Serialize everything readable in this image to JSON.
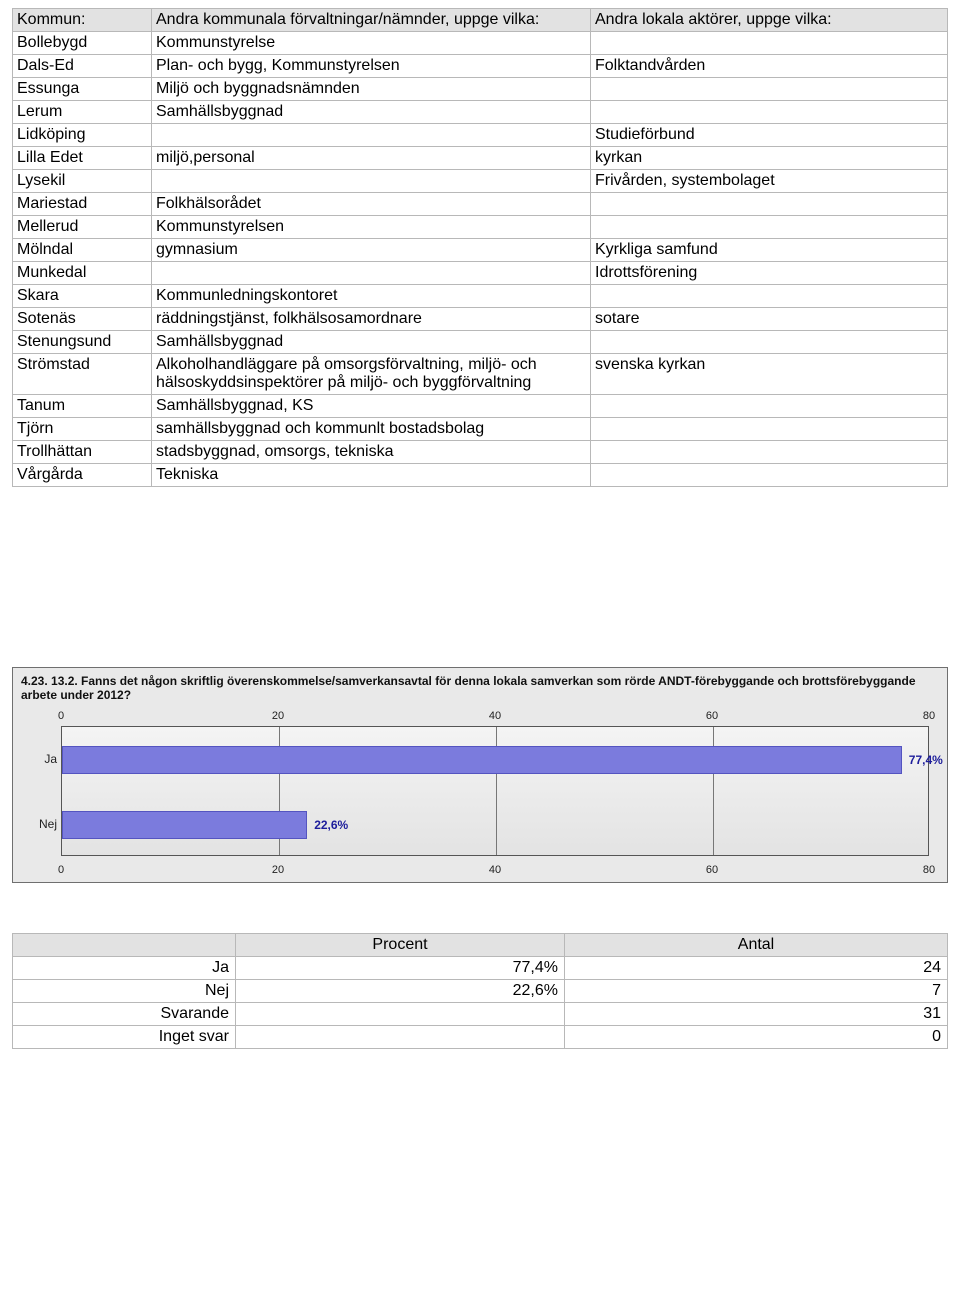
{
  "table": {
    "headers": {
      "kommun": "Kommun:",
      "andra_kommunala": "Andra kommunala förvaltningar/nämnder, uppge vilka:",
      "andra_lokala": "Andra lokala aktörer, uppge vilka:"
    },
    "rows": [
      {
        "kommun": "Bollebygd",
        "c1": "Kommunstyrelse",
        "c2": ""
      },
      {
        "kommun": "Dals-Ed",
        "c1": "Plan- och bygg, Kommunstyrelsen",
        "c2": "Folktandvården"
      },
      {
        "kommun": "Essunga",
        "c1": "Miljö och byggnadsnämnden",
        "c2": ""
      },
      {
        "kommun": "Lerum",
        "c1": "Samhällsbyggnad",
        "c2": ""
      },
      {
        "kommun": "Lidköping",
        "c1": "",
        "c2": "Studieförbund"
      },
      {
        "kommun": "Lilla Edet",
        "c1": "miljö,personal",
        "c2": "kyrkan"
      },
      {
        "kommun": "Lysekil",
        "c1": "",
        "c2": "Frivården, systembolaget"
      },
      {
        "kommun": "Mariestad",
        "c1": "Folkhälsorådet",
        "c2": ""
      },
      {
        "kommun": "Mellerud",
        "c1": "Kommunstyrelsen",
        "c2": ""
      },
      {
        "kommun": "Mölndal",
        "c1": "gymnasium",
        "c2": "Kyrkliga samfund"
      },
      {
        "kommun": "Munkedal",
        "c1": "",
        "c2": "Idrottsförening"
      },
      {
        "kommun": "Skara",
        "c1": "Kommunledningskontoret",
        "c2": ""
      },
      {
        "kommun": "Sotenäs",
        "c1": "räddningstjänst, folkhälsosamordnare",
        "c2": "sotare"
      },
      {
        "kommun": "Stenungsund",
        "c1": "Samhällsbyggnad",
        "c2": ""
      },
      {
        "kommun": "Strömstad",
        "c1": "Alkoholhandläggare på omsorgsförvaltning, miljö- och hälsoskyddsinspektörer på miljö- och byggförvaltning",
        "c2": "svenska kyrkan"
      },
      {
        "kommun": "Tanum",
        "c1": "Samhällsbyggnad, KS",
        "c2": ""
      },
      {
        "kommun": "Tjörn",
        "c1": "samhällsbyggnad och kommunlt bostadsbolag",
        "c2": ""
      },
      {
        "kommun": "Trollhättan",
        "c1": "stadsbyggnad, omsorgs, tekniska",
        "c2": ""
      },
      {
        "kommun": "Vårgårda",
        "c1": "Tekniska",
        "c2": ""
      }
    ]
  },
  "chart_data": {
    "type": "bar",
    "orientation": "horizontal",
    "title": "4.23. 13.2. Fanns det någon skriftlig överenskommelse/samverkansavtal för denna lokala samverkan som rörde ANDT-förebyggande och brottsförebyggande arbete under 2012?",
    "categories": [
      "Ja",
      "Nej"
    ],
    "values": [
      77.4,
      22.6
    ],
    "value_labels": [
      "77,4%",
      "22,6%"
    ],
    "xlim": [
      0,
      80
    ],
    "ticks": [
      0,
      20,
      40,
      60,
      80
    ]
  },
  "summary": {
    "headers": {
      "procent": "Procent",
      "antal": "Antal"
    },
    "rows": [
      {
        "label": "Ja",
        "procent": "77,4%",
        "antal": "24"
      },
      {
        "label": "Nej",
        "procent": "22,6%",
        "antal": "7"
      },
      {
        "label": "Svarande",
        "procent": "",
        "antal": "31"
      },
      {
        "label": "Inget svar",
        "procent": "",
        "antal": "0"
      }
    ]
  }
}
